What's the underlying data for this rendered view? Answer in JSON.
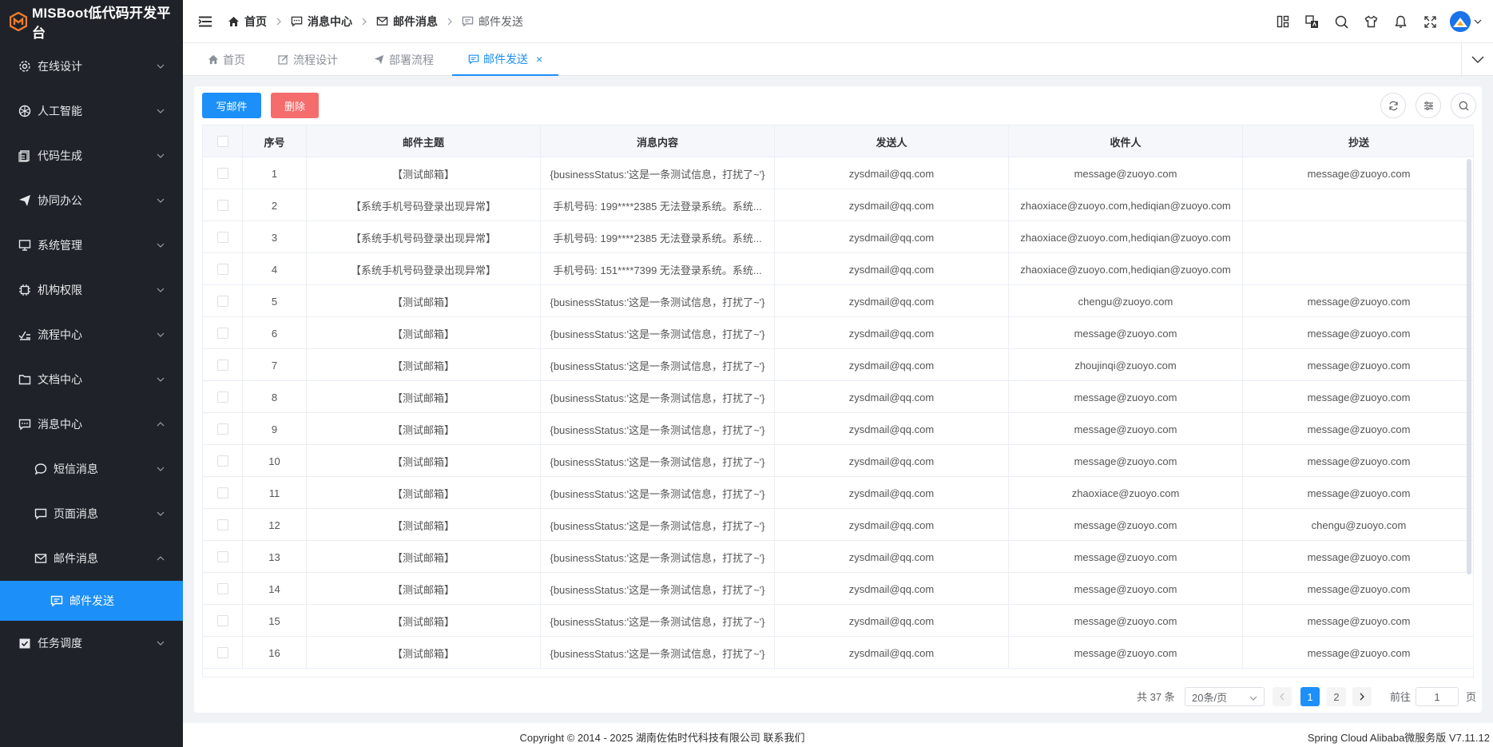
{
  "app": {
    "title": "MISBoot低代码开发平台"
  },
  "sidebar": {
    "items": [
      {
        "label": "在线设计",
        "icon": "gear-icon"
      },
      {
        "label": "人工智能",
        "icon": "ai-icon"
      },
      {
        "label": "代码生成",
        "icon": "code-icon"
      },
      {
        "label": "协同办公",
        "icon": "paper-plane-icon"
      },
      {
        "label": "系统管理",
        "icon": "monitor-icon"
      },
      {
        "label": "机构权限",
        "icon": "chip-icon"
      },
      {
        "label": "流程中心",
        "icon": "flow-icon"
      },
      {
        "label": "文档中心",
        "icon": "folder-icon"
      },
      {
        "label": "消息中心",
        "icon": "message-icon"
      },
      {
        "label": "短信消息",
        "icon": "chat-icon"
      },
      {
        "label": "页面消息",
        "icon": "chat-square-icon"
      },
      {
        "label": "邮件消息",
        "icon": "mail-icon"
      },
      {
        "label": "邮件发送",
        "icon": "message-box-icon"
      },
      {
        "label": "任务调度",
        "icon": "calendar-check-icon"
      }
    ]
  },
  "breadcrumb": {
    "items": [
      {
        "label": "首页",
        "icon": "home-icon"
      },
      {
        "label": "消息中心",
        "icon": "message-icon"
      },
      {
        "label": "邮件消息",
        "icon": "mail-icon"
      },
      {
        "label": "邮件发送",
        "icon": "message-box-icon"
      }
    ]
  },
  "tabs": [
    {
      "label": "首页",
      "icon": "home-icon"
    },
    {
      "label": "流程设计",
      "icon": "edit-icon"
    },
    {
      "label": "部署流程",
      "icon": "send-icon"
    },
    {
      "label": "邮件发送",
      "icon": "message-box-icon",
      "active": true,
      "close": "×"
    }
  ],
  "toolbar": {
    "write_label": "写邮件",
    "delete_label": "删除"
  },
  "table": {
    "headers": [
      "序号",
      "邮件主题",
      "消息内容",
      "发送人",
      "收件人",
      "抄送"
    ],
    "rows": [
      [
        "1",
        "【测试邮箱】",
        "{businessStatus:'这是一条测试信息，打扰了~'}",
        "zysdmail@qq.com",
        "message@zuoyo.com",
        "message@zuoyo.com"
      ],
      [
        "2",
        "【系统手机号码登录出现异常】",
        "手机号码: 199****2385 无法登录系统。系统...",
        "zysdmail@qq.com",
        "zhaoxiace@zuoyo.com,hediqian@zuoyo.com",
        ""
      ],
      [
        "3",
        "【系统手机号码登录出现异常】",
        "手机号码: 199****2385 无法登录系统。系统...",
        "zysdmail@qq.com",
        "zhaoxiace@zuoyo.com,hediqian@zuoyo.com",
        ""
      ],
      [
        "4",
        "【系统手机号码登录出现异常】",
        "手机号码: 151****7399 无法登录系统。系统...",
        "zysdmail@qq.com",
        "zhaoxiace@zuoyo.com,hediqian@zuoyo.com",
        ""
      ],
      [
        "5",
        "【测试邮箱】",
        "{businessStatus:'这是一条测试信息，打扰了~'}",
        "zysdmail@qq.com",
        "chengu@zuoyo.com",
        "message@zuoyo.com"
      ],
      [
        "6",
        "【测试邮箱】",
        "{businessStatus:'这是一条测试信息，打扰了~'}",
        "zysdmail@qq.com",
        "message@zuoyo.com",
        "message@zuoyo.com"
      ],
      [
        "7",
        "【测试邮箱】",
        "{businessStatus:'这是一条测试信息，打扰了~'}",
        "zysdmail@qq.com",
        "zhoujinqi@zuoyo.com",
        "message@zuoyo.com"
      ],
      [
        "8",
        "【测试邮箱】",
        "{businessStatus:'这是一条测试信息，打扰了~'}",
        "zysdmail@qq.com",
        "message@zuoyo.com",
        "message@zuoyo.com"
      ],
      [
        "9",
        "【测试邮箱】",
        "{businessStatus:'这是一条测试信息，打扰了~'}",
        "zysdmail@qq.com",
        "message@zuoyo.com",
        "message@zuoyo.com"
      ],
      [
        "10",
        "【测试邮箱】",
        "{businessStatus:'这是一条测试信息，打扰了~'}",
        "zysdmail@qq.com",
        "message@zuoyo.com",
        "message@zuoyo.com"
      ],
      [
        "11",
        "【测试邮箱】",
        "{businessStatus:'这是一条测试信息，打扰了~'}",
        "zysdmail@qq.com",
        "zhaoxiace@zuoyo.com",
        "message@zuoyo.com"
      ],
      [
        "12",
        "【测试邮箱】",
        "{businessStatus:'这是一条测试信息，打扰了~'}",
        "zysdmail@qq.com",
        "message@zuoyo.com",
        "chengu@zuoyo.com"
      ],
      [
        "13",
        "【测试邮箱】",
        "{businessStatus:'这是一条测试信息，打扰了~'}",
        "zysdmail@qq.com",
        "message@zuoyo.com",
        "message@zuoyo.com"
      ],
      [
        "14",
        "【测试邮箱】",
        "{businessStatus:'这是一条测试信息，打扰了~'}",
        "zysdmail@qq.com",
        "message@zuoyo.com",
        "message@zuoyo.com"
      ],
      [
        "15",
        "【测试邮箱】",
        "{businessStatus:'这是一条测试信息，打扰了~'}",
        "zysdmail@qq.com",
        "message@zuoyo.com",
        "message@zuoyo.com"
      ],
      [
        "16",
        "【测试邮箱】",
        "{businessStatus:'这是一条测试信息，打扰了~'}",
        "zysdmail@qq.com",
        "message@zuoyo.com",
        "message@zuoyo.com"
      ]
    ]
  },
  "pagination": {
    "total": "共 37 条",
    "page_size": "20条/页",
    "pages": [
      "1",
      "2"
    ],
    "current": "1",
    "goto_label": "前往",
    "goto_value": "1",
    "goto_unit": "页"
  },
  "footer": {
    "copyright": "Copyright © 2014 - 2025 湖南佐佑时代科技有限公司 联系我们",
    "version": "Spring Cloud Alibaba微服务版 V7.11.12"
  },
  "colors": {
    "primary": "#1d8ff8",
    "danger": "#f56c6c",
    "sidebar_bg": "#1f2329",
    "logo": "#f07c2a"
  }
}
